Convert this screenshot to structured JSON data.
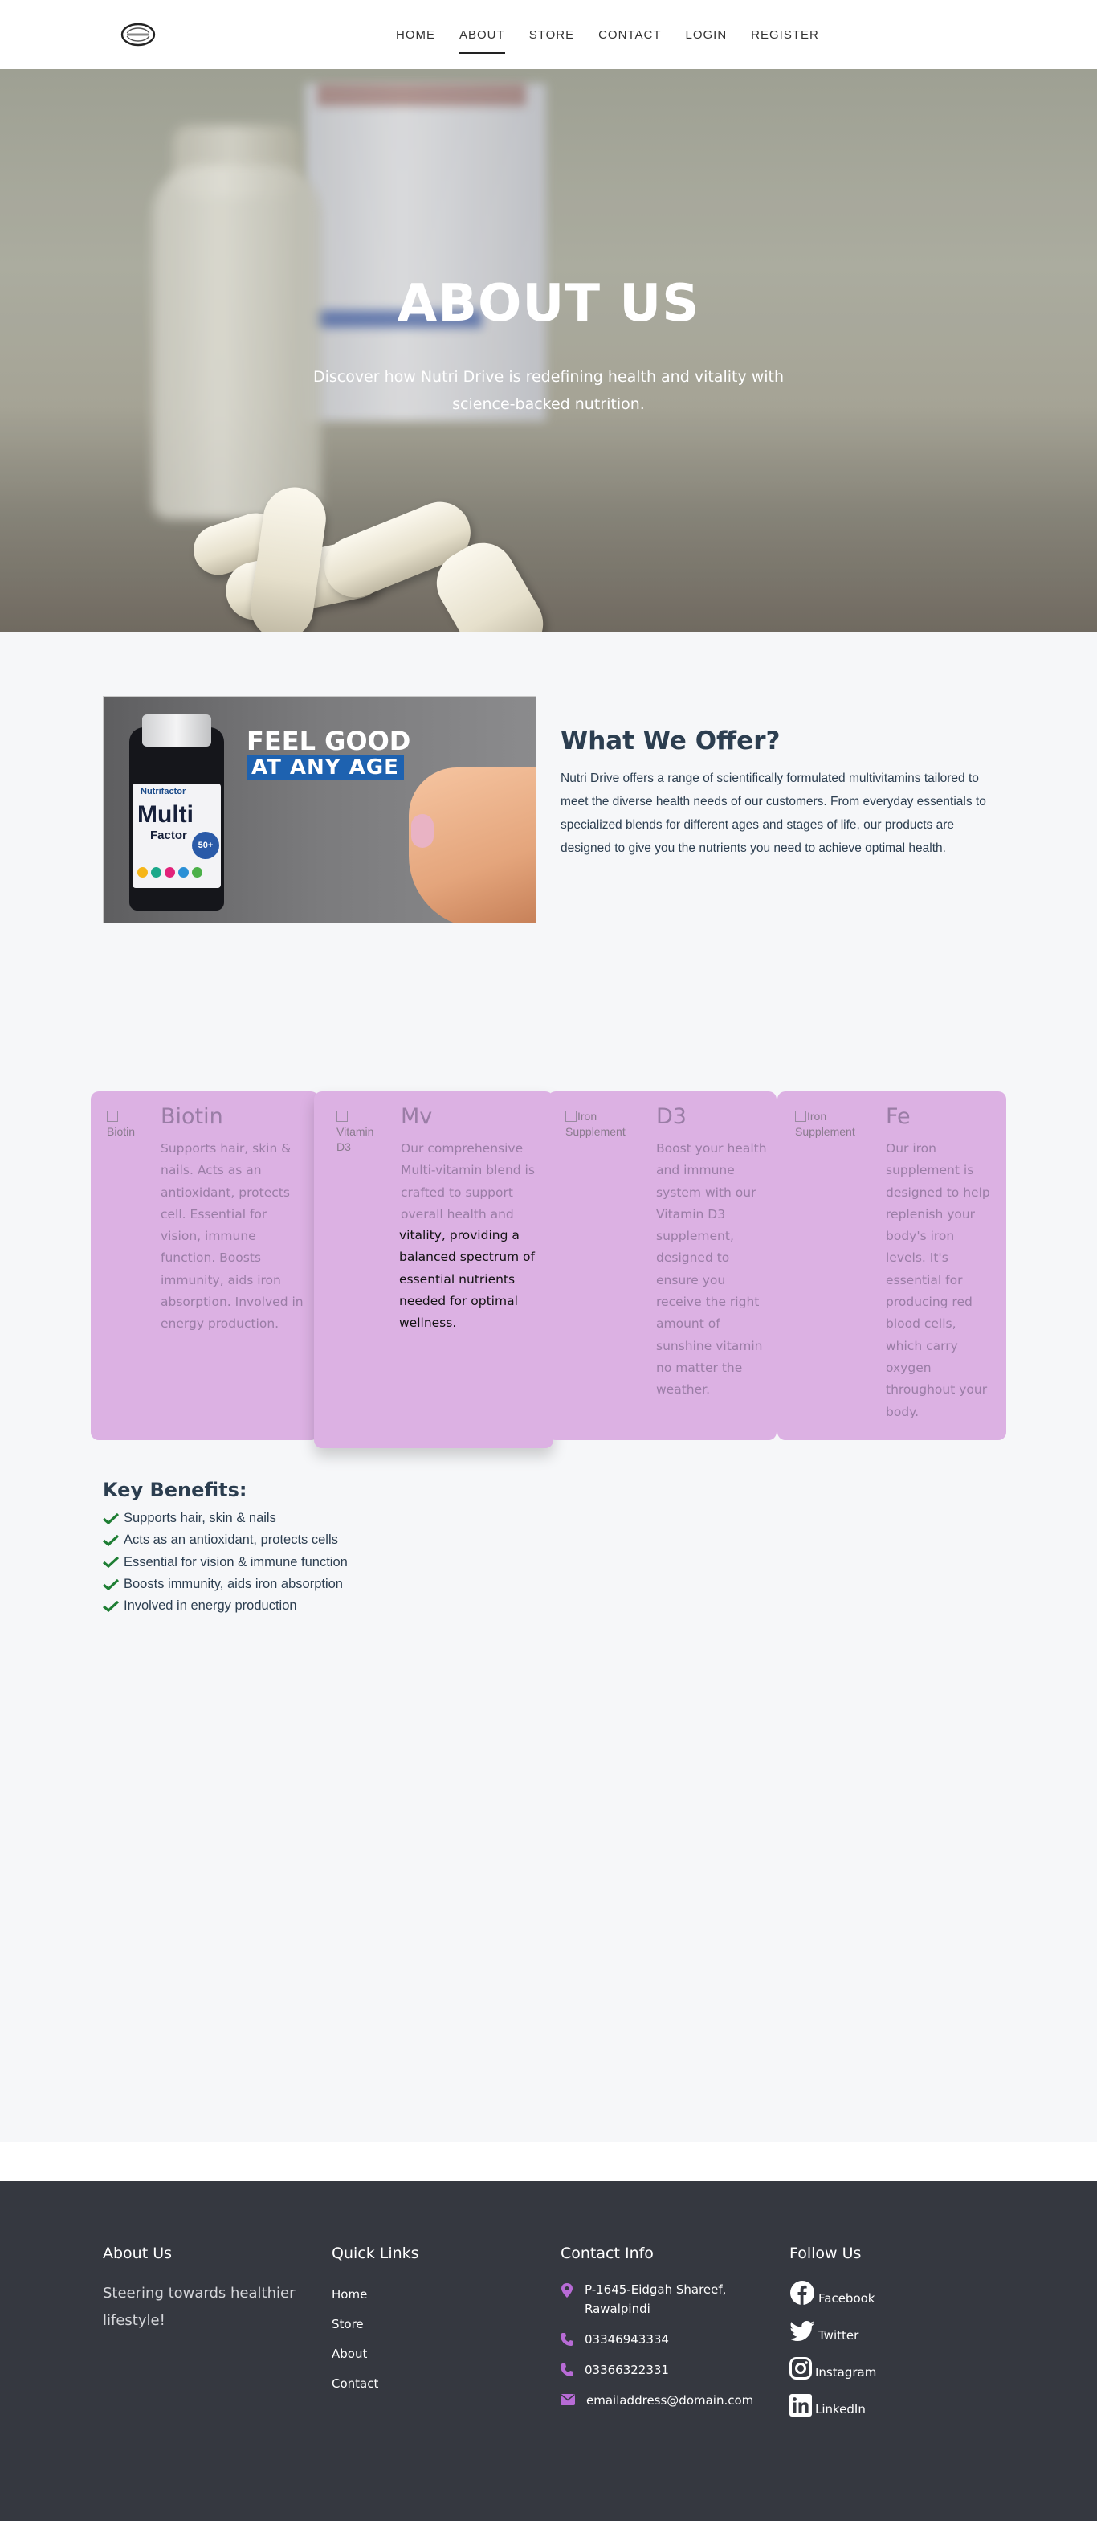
{
  "nav": {
    "logo_alt": "Nutri Drive logo",
    "links": [
      {
        "label": "HOME"
      },
      {
        "label": "ABOUT"
      },
      {
        "label": "STORE"
      },
      {
        "label": "CONTACT"
      },
      {
        "label": "LOGIN"
      },
      {
        "label": "REGISTER"
      }
    ],
    "active": "ABOUT"
  },
  "hero": {
    "title": "ABOUT US",
    "subtitle": "Discover how Nutri Drive is redefining health and vitality with science-backed nutrition."
  },
  "offer": {
    "banner": {
      "headline": "FEEL GOOD",
      "subheadline": "AT ANY AGE",
      "brand": "Nutrifactor",
      "product": "Multi",
      "product_sub": "Factor",
      "badge": "50+"
    },
    "heading": "What We Offer?",
    "body": "Nutri Drive offers a range of scientifically formulated multivitamins tailored to meet the diverse health needs of our customers. From everyday essentials to specialized blends for different ages and stages of life, our products are designed to give you the nutrients you need to achieve optimal health."
  },
  "cards": [
    {
      "img_alt": "Biotin",
      "title": "Biotin",
      "text": "Supports hair, skin & nails. Acts as an antioxidant, protects cell. Essential for vision, immune function. Boosts immunity, aids iron absorption. Involved in energy production."
    },
    {
      "img_alt": "Vitamin D3",
      "title": "Mv",
      "text_top": "Our comprehensive Multi-vitamin blend is crafted to support overall health and",
      "text_bottom": "vitality, providing a balanced spectrum of essential nutrients needed for optimal wellness."
    },
    {
      "img_alt": "Iron Supplement",
      "title": "D3",
      "text": "Boost your health and immune system with our Vitamin D3 supplement, designed to ensure you receive the right amount of sunshine vitamin no matter the weather."
    },
    {
      "img_alt": "Iron Supplement",
      "title": "Fe",
      "text": "Our iron supplement is designed to help replenish your body's iron levels. It's essential for producing red blood cells, which carry oxygen throughout your body."
    }
  ],
  "benefits": {
    "title": "Key Benefits:",
    "items": [
      "Supports hair, skin & nails",
      "Acts as an antioxidant, protects cells",
      "Essential for vision & immune function",
      "Boosts immunity, aids iron absorption",
      "Involved in energy production"
    ]
  },
  "footer": {
    "about": {
      "heading": "About Us",
      "text": "Steering towards healthier lifestyle!"
    },
    "quick_links": {
      "heading": "Quick Links",
      "links": [
        "Home",
        "Store",
        "About",
        "Contact"
      ]
    },
    "contact": {
      "heading": "Contact Info",
      "address": "P-1645-Eidgah Shareef, Rawalpindi",
      "phone1": "03346943334",
      "phone2": "03366322331",
      "email": "emailaddress@domain.com"
    },
    "follow": {
      "heading": "Follow Us",
      "links": [
        {
          "label": "Facebook",
          "icon": "facebook-icon"
        },
        {
          "label": "Twitter",
          "icon": "twitter-icon"
        },
        {
          "label": "Instagram",
          "icon": "instagram-icon"
        },
        {
          "label": "LinkedIn",
          "icon": "linkedin-icon"
        }
      ]
    }
  },
  "colors": {
    "card_bg": "#dcb1e3",
    "card_text": "#9a7da6",
    "footer_bg": "#353840",
    "heading": "#2c3e50",
    "contact_icon": "#b86bd6",
    "check": "#1e7e34"
  }
}
